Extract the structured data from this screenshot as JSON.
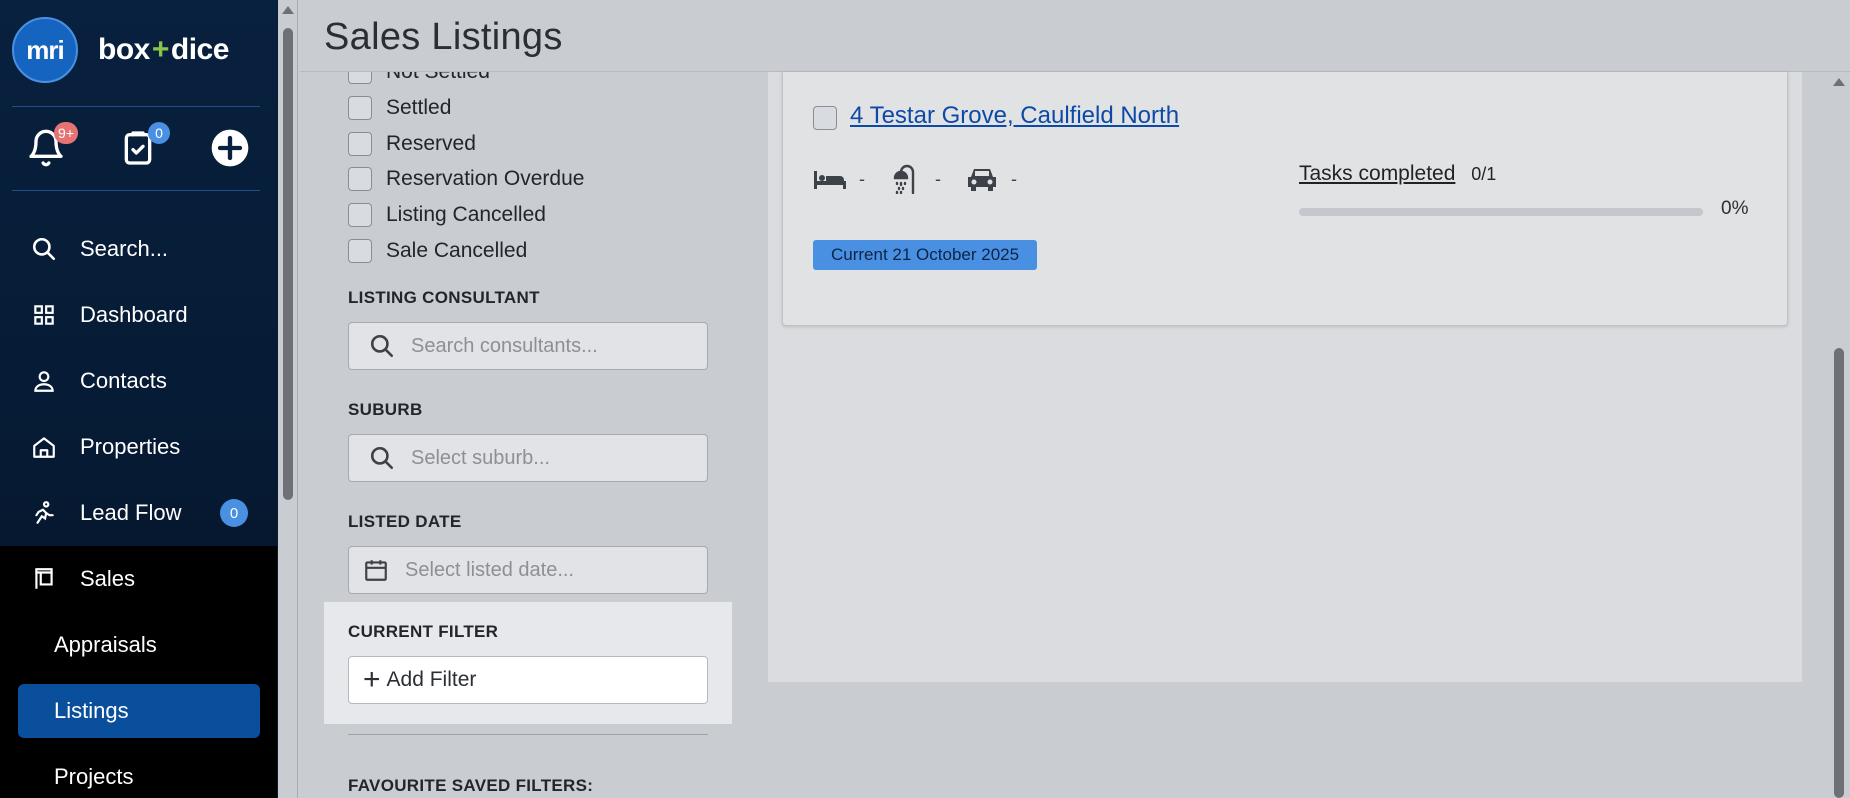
{
  "app": {
    "logo_text": "mri",
    "brand_left": "box",
    "brand_plus": "+",
    "brand_right": "dice"
  },
  "quick": {
    "notifications_badge": "9+",
    "tasks_badge": "0"
  },
  "nav": {
    "search": "Search...",
    "dashboard": "Dashboard",
    "contacts": "Contacts",
    "properties": "Properties",
    "lead_flow": "Lead Flow",
    "lead_flow_badge": "0",
    "sales": "Sales",
    "appraisals": "Appraisals",
    "listings": "Listings",
    "projects": "Projects"
  },
  "header": {
    "title": "Sales Listings"
  },
  "filters": {
    "statuses": [
      "Not Settled",
      "Settled",
      "Reserved",
      "Reservation Overdue",
      "Listing Cancelled",
      "Sale Cancelled"
    ],
    "consultant_label": "LISTING CONSULTANT",
    "consultant_placeholder": "Search consultants...",
    "suburb_label": "SUBURB",
    "suburb_placeholder": "Select suburb...",
    "listed_date_label": "LISTED DATE",
    "listed_date_placeholder": "Select listed date...",
    "current_filter_label": "CURRENT FILTER",
    "add_filter": "Add Filter",
    "favourite_label": "FAVOURITE SAVED FILTERS:"
  },
  "listing": {
    "address": "4 Testar Grove, Caulfield North",
    "bedrooms": "-",
    "bathrooms": "-",
    "car_spaces": "-",
    "tasks_label": "Tasks completed",
    "tasks_count": "0/1",
    "progress_percent": 0,
    "progress_text": "0%",
    "status": "Current 21 October 2025"
  },
  "colors": {
    "sidebar_bg": "#08213f",
    "accent": "#4a90e2",
    "selected_nav": "#0a4f9c",
    "link": "#0d4aa8",
    "notification_badge": "#e57373"
  }
}
